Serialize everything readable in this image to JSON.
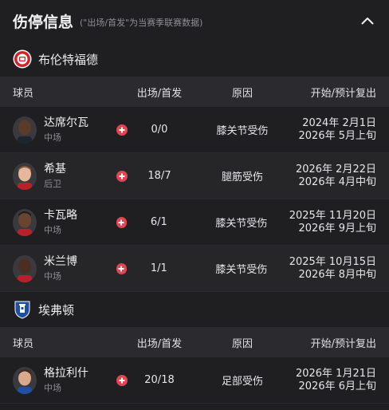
{
  "header": {
    "title": "伤停信息",
    "subtitle": "(\"出场/首发\"为当赛季联赛数据)"
  },
  "colors": {
    "injury_badge": "#e24552",
    "background": "#1f1f22",
    "table_header": "#2b2b2f"
  },
  "teams": [
    {
      "name": "布伦特福德",
      "crest_icon": "brentford-crest-icon",
      "columns": {
        "player": "球员",
        "stat": "出场/首发",
        "reason": "原因",
        "date": "开始/预计复出"
      },
      "players": [
        {
          "name": "达席尔瓦",
          "position": "中场",
          "stat": "0/0",
          "reason": "膝关节受伤",
          "date_line1": "2024年 2月1日",
          "date_line2": "2026年 5月上旬"
        },
        {
          "name": "希基",
          "position": "后卫",
          "stat": "18/7",
          "reason": "腿筋受伤",
          "date_line1": "2026年 2月22日",
          "date_line2": "2026年 4月中旬"
        },
        {
          "name": "卡瓦略",
          "position": "中场",
          "stat": "6/1",
          "reason": "膝关节受伤",
          "date_line1": "2025年 11月20日",
          "date_line2": "2026年 9月上旬"
        },
        {
          "name": "米兰博",
          "position": "中场",
          "stat": "1/1",
          "reason": "膝关节受伤",
          "date_line1": "2025年 10月15日",
          "date_line2": "2026年 8月中旬"
        }
      ]
    },
    {
      "name": "埃弗顿",
      "crest_icon": "everton-crest-icon",
      "columns": {
        "player": "球员",
        "stat": "出场/首发",
        "reason": "原因",
        "date": "开始/预计复出"
      },
      "players": [
        {
          "name": "格拉利什",
          "position": "中场",
          "stat": "20/18",
          "reason": "足部受伤",
          "date_line1": "2026年 1月21日",
          "date_line2": "2026年 6月上旬"
        }
      ]
    }
  ]
}
